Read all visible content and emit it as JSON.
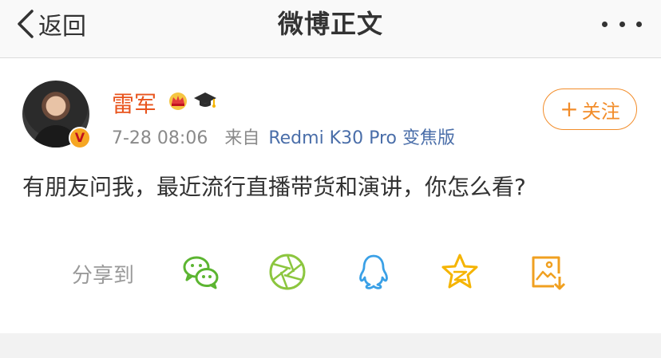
{
  "nav": {
    "back_label": "返回",
    "title": "微博正文",
    "more_icon": "more-dots-icon"
  },
  "post": {
    "username": "雷军",
    "badges": [
      "crown-icon",
      "graduation-cap-icon"
    ],
    "verified_icon": "verified-v-badge",
    "time": "7-28 08:06",
    "from_label": "来自",
    "device": "Redmi K30 Pro 变焦版",
    "follow_label": "关注",
    "text": "有朋友问我，最近流行直播带货和演讲，你怎么看?"
  },
  "share": {
    "label": "分享到",
    "targets": [
      "wechat-icon",
      "moments-icon",
      "qq-icon",
      "qzone-icon",
      "save-image-icon"
    ]
  },
  "colors": {
    "username": "#e8541d",
    "follow": "#f28c29",
    "device_link": "#4a6ea9",
    "share_green": "#5cb531",
    "qq_blue": "#3aa0e6",
    "qzone_yellow": "#f5b400",
    "save_orange": "#f0a020"
  }
}
